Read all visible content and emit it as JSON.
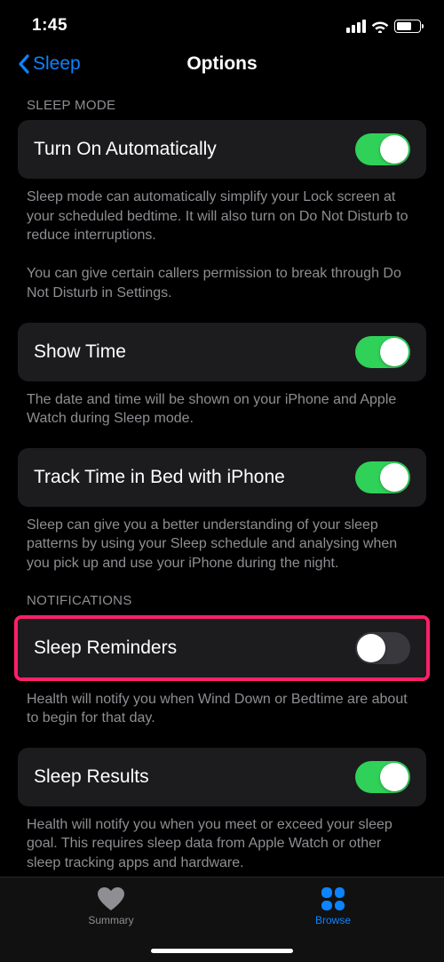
{
  "status": {
    "time": "1:45"
  },
  "nav": {
    "back": "Sleep",
    "title": "Options"
  },
  "sections": {
    "sleepMode": {
      "header": "SLEEP MODE",
      "turnOn": {
        "label": "Turn On Automatically",
        "footer": "Sleep mode can automatically simplify your Lock screen at your scheduled bedtime. It will also turn on Do Not Disturb to reduce interruptions.\n\nYou can give certain callers permission to break through Do Not Disturb in Settings."
      },
      "showTime": {
        "label": "Show Time",
        "footer": "The date and time will be shown on your iPhone and Apple Watch during Sleep mode."
      },
      "trackTime": {
        "label": "Track Time in Bed with iPhone",
        "footer": "Sleep can give you a better understanding of your sleep patterns by using your Sleep schedule and analysing when you pick up and use your iPhone during the night."
      }
    },
    "notifications": {
      "header": "NOTIFICATIONS",
      "reminders": {
        "label": "Sleep Reminders",
        "footer": "Health will notify you when Wind Down or Bedtime are about to begin for that day."
      },
      "results": {
        "label": "Sleep Results",
        "footer": "Health will notify you when you meet or exceed your sleep goal. This requires sleep data from Apple Watch or other sleep tracking apps and hardware."
      }
    }
  },
  "tabs": {
    "summary": "Summary",
    "browse": "Browse"
  }
}
